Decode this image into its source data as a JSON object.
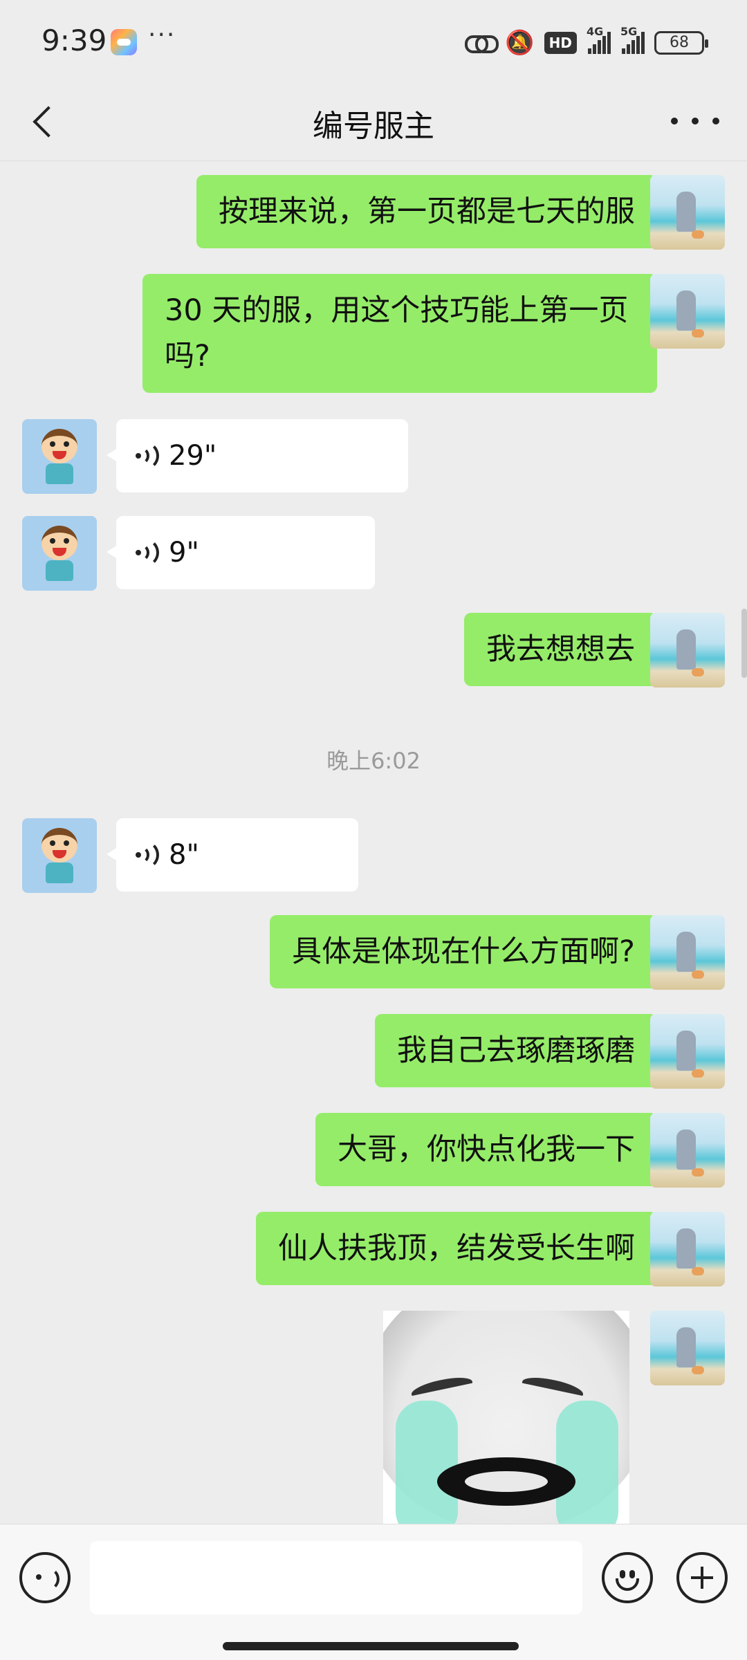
{
  "status_bar": {
    "time": "9:39",
    "overflow": "···",
    "hd_label": "HD",
    "net1": "4G",
    "net2": "5G",
    "battery": "68",
    "icons": [
      "game-app-icon",
      "link-icon",
      "mute-bell-icon",
      "signal-icon",
      "battery-icon"
    ]
  },
  "nav": {
    "title": "编号服主",
    "icons": [
      "back-icon",
      "more-icon"
    ]
  },
  "messages": [
    {
      "from": "self",
      "type": "text",
      "text": "按理来说，第一页都是七天的服"
    },
    {
      "from": "self",
      "type": "text",
      "text": "30 天的服，用这个技巧能上第一页吗?"
    },
    {
      "from": "friend",
      "type": "voice",
      "duration": "29\""
    },
    {
      "from": "friend",
      "type": "voice",
      "duration": "9\""
    },
    {
      "from": "self",
      "type": "text",
      "text": "我去想想去"
    },
    {
      "type": "timestamp",
      "text": "晚上6:02"
    },
    {
      "from": "friend",
      "type": "voice",
      "duration": "8\""
    },
    {
      "from": "self",
      "type": "text",
      "text": "具体是体现在什么方面啊?"
    },
    {
      "from": "self",
      "type": "text",
      "text": "我自己去琢磨琢磨"
    },
    {
      "from": "self",
      "type": "text",
      "text": "大哥，你快点化我一下"
    },
    {
      "from": "self",
      "type": "text",
      "text": "仙人扶我顶，结发受长生啊"
    },
    {
      "from": "self",
      "type": "sticker",
      "sticker": "crying-panda-face"
    }
  ],
  "input_bar": {
    "value": "",
    "icons": [
      "voice-input-icon",
      "emoji-icon",
      "plus-icon"
    ]
  },
  "colors": {
    "self_bubble": "#95ec69",
    "friend_bubble": "#ffffff",
    "background": "#ededed",
    "timestamp": "#9a9a9a"
  }
}
